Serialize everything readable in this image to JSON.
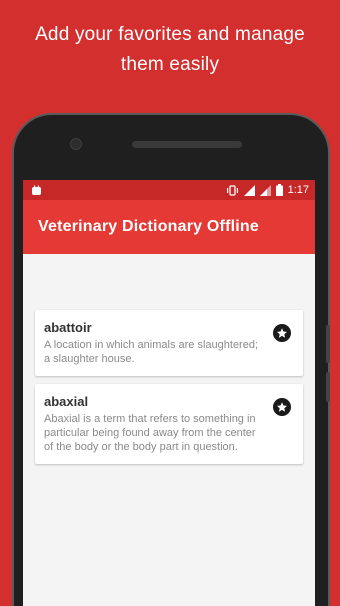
{
  "promo": {
    "line1": "Add your favorites and manage",
    "line2": "them easily"
  },
  "status_bar": {
    "time": "1:17",
    "icons": [
      "app-notification-icon",
      "vibrate-icon",
      "signal-icon",
      "signal-icon-2",
      "battery-icon"
    ]
  },
  "app_bar": {
    "title": "Veterinary Dictionary Offline"
  },
  "favorites": [
    {
      "word": "abattoir",
      "definition": "A location in which animals are slaughtered; a slaughter house.",
      "icon": "star-icon"
    },
    {
      "word": "abaxial",
      "definition": "Abaxial is a term that refers to something in particular being found away from the center of the body or the body part in question.",
      "icon": "star-icon"
    }
  ],
  "colors": {
    "background": "#d32f2f",
    "status_bar": "#c62828",
    "app_bar": "#e53935",
    "screen": "#f4f4f4"
  }
}
